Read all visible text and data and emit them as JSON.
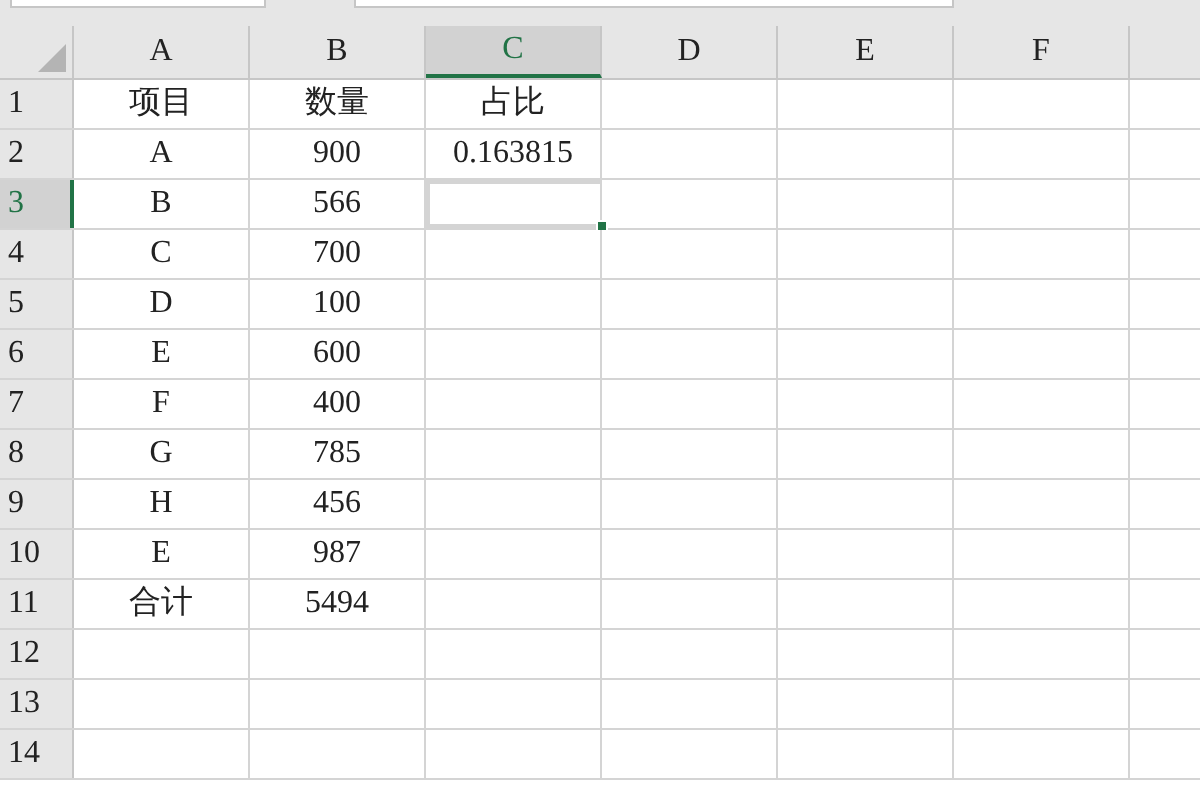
{
  "columns": [
    {
      "label": "A",
      "selected": false
    },
    {
      "label": "B",
      "selected": false
    },
    {
      "label": "C",
      "selected": true
    },
    {
      "label": "D",
      "selected": false
    },
    {
      "label": "E",
      "selected": false
    },
    {
      "label": "F",
      "selected": false
    }
  ],
  "rows": [
    {
      "header": "1",
      "selected": false,
      "cells": [
        "项目",
        "数量",
        "占比"
      ]
    },
    {
      "header": "2",
      "selected": false,
      "cells": [
        "A",
        "900",
        "0.163815"
      ]
    },
    {
      "header": "3",
      "selected": true,
      "cells": [
        "B",
        "566"
      ]
    },
    {
      "header": "4",
      "selected": false,
      "cells": [
        "C",
        "700"
      ]
    },
    {
      "header": "5",
      "selected": false,
      "cells": [
        "D",
        "100"
      ]
    },
    {
      "header": "6",
      "selected": false,
      "cells": [
        "E",
        "600"
      ]
    },
    {
      "header": "7",
      "selected": false,
      "cells": [
        "F",
        "400"
      ]
    },
    {
      "header": "8",
      "selected": false,
      "cells": [
        "G",
        "785"
      ]
    },
    {
      "header": "9",
      "selected": false,
      "cells": [
        "H",
        "456"
      ]
    },
    {
      "header": "10",
      "selected": false,
      "cells": [
        "E",
        "987"
      ]
    },
    {
      "header": "11",
      "selected": false,
      "cells": [
        "合计",
        "5494"
      ]
    },
    {
      "header": "12",
      "selected": false,
      "cells": []
    },
    {
      "header": "13",
      "selected": false,
      "cells": []
    },
    {
      "header": "14",
      "selected": false,
      "cells": []
    }
  ]
}
